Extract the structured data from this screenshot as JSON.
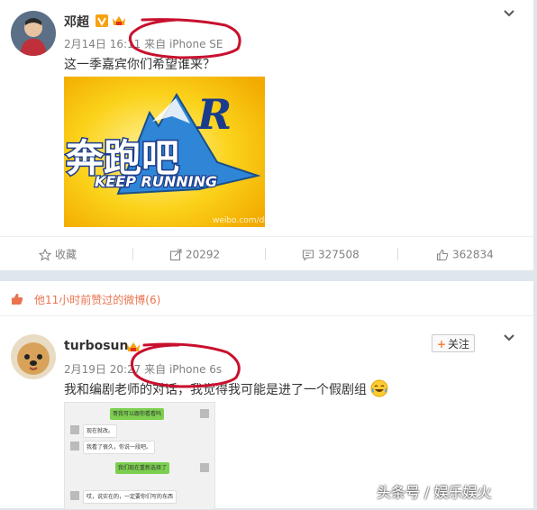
{
  "post1": {
    "author": "邓超",
    "time": "2月14日 16:11",
    "source": "来自 iPhone SE",
    "text": "这一季嘉宾你们希望谁来？",
    "image": {
      "logo_cn": "奔跑吧",
      "logo_en": "KEEP RUNNING",
      "logo_r": "R",
      "watermark": "weibo.com/dc"
    },
    "actions": {
      "favorite": "收藏",
      "forward": "20292",
      "comment": "327508",
      "like": "362834"
    }
  },
  "section": {
    "text": "他11小时前赞过的微博(6)"
  },
  "post2": {
    "author": "turbosun",
    "time": "2月19日 20:27",
    "source": "来自 iPhone 6s",
    "text": "我和编剧老师的对话，我觉得我可能是进了一个假剧组",
    "follow": "关注",
    "chat": [
      "哥我可以跟你看看吗",
      "现在就改。",
      "我看了很久，你说一段吧。",
      "我们现在重新选择了",
      "哎，说实在的，一定要你们写的东西"
    ]
  },
  "watermark": "头条号 / 娱乐娱火",
  "colors": {
    "link": "#eb7350",
    "annotation": "#c8102e",
    "chat_green": "#7ccf4f"
  }
}
